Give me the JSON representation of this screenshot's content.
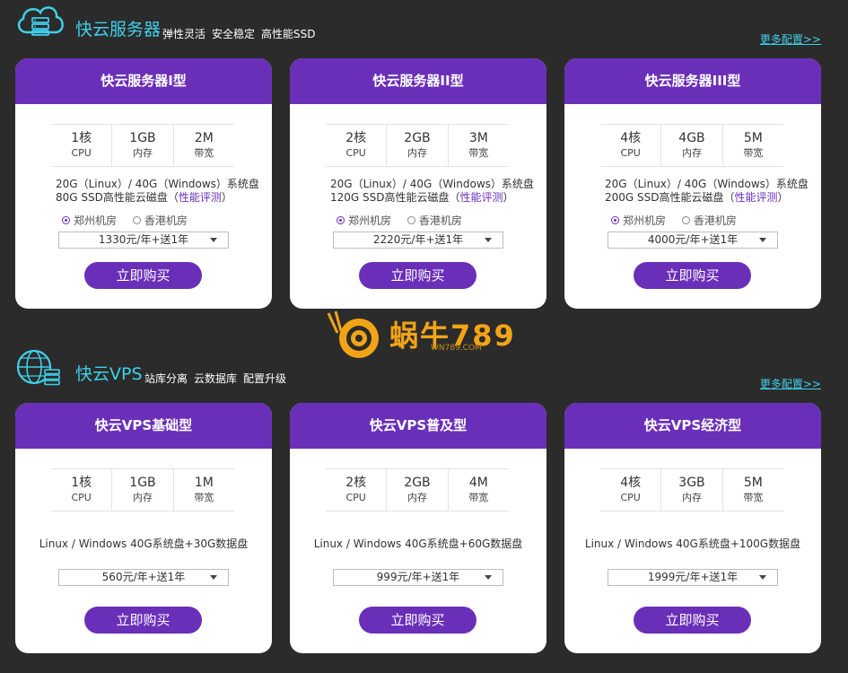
{
  "servers": {
    "title": "快云服务器",
    "tags": [
      "弹性灵活",
      "安全稳定",
      "高性能SSD"
    ],
    "more": "更多配置>>",
    "plans": [
      {
        "name": "快云服务器I型",
        "specs": [
          {
            "value": "1核",
            "label": "CPU"
          },
          {
            "value": "1GB",
            "label": "内存"
          },
          {
            "value": "2M",
            "label": "带宽"
          }
        ],
        "disk_line1": "20G（Linux）/ 40G（Windows）系统盘",
        "disk_line2": "80G SSD高性能云磁盘（",
        "eval": "性能评测",
        "eval_close": "）",
        "rooms": [
          "郑州机房",
          "香港机房"
        ],
        "price": "1330元/年+送1年",
        "buy": "立即购买"
      },
      {
        "name": "快云服务器II型",
        "specs": [
          {
            "value": "2核",
            "label": "CPU"
          },
          {
            "value": "2GB",
            "label": "内存"
          },
          {
            "value": "3M",
            "label": "带宽"
          }
        ],
        "disk_line1": "20G（Linux）/ 40G（Windows）系统盘",
        "disk_line2": "120G SSD高性能云磁盘（",
        "eval": "性能评测",
        "eval_close": "）",
        "rooms": [
          "郑州机房",
          "香港机房"
        ],
        "price": "2220元/年+送1年",
        "buy": "立即购买"
      },
      {
        "name": "快云服务器III型",
        "specs": [
          {
            "value": "4核",
            "label": "CPU"
          },
          {
            "value": "4GB",
            "label": "内存"
          },
          {
            "value": "5M",
            "label": "带宽"
          }
        ],
        "disk_line1": "20G（Linux）/ 40G（Windows）系统盘",
        "disk_line2": "200G SSD高性能云磁盘（",
        "eval": "性能评测",
        "eval_close": "）",
        "rooms": [
          "郑州机房",
          "香港机房"
        ],
        "price": "4000元/年+送1年",
        "buy": "立即购买"
      }
    ]
  },
  "vps": {
    "title": "快云VPS",
    "tags": [
      "站库分离",
      "云数据库",
      "配置升级"
    ],
    "more": "更多配置>>",
    "plans": [
      {
        "name": "快云VPS基础型",
        "specs": [
          {
            "value": "1核",
            "label": "CPU"
          },
          {
            "value": "1GB",
            "label": "内存"
          },
          {
            "value": "1M",
            "label": "带宽"
          }
        ],
        "disk": "Linux / Windows 40G系统盘+30G数据盘",
        "price": "560元/年+送1年",
        "buy": "立即购买"
      },
      {
        "name": "快云VPS普及型",
        "specs": [
          {
            "value": "2核",
            "label": "CPU"
          },
          {
            "value": "2GB",
            "label": "内存"
          },
          {
            "value": "4M",
            "label": "带宽"
          }
        ],
        "disk": "Linux / Windows 40G系统盘+60G数据盘",
        "price": "999元/年+送1年",
        "buy": "立即购买"
      },
      {
        "name": "快云VPS经济型",
        "specs": [
          {
            "value": "4核",
            "label": "CPU"
          },
          {
            "value": "3GB",
            "label": "内存"
          },
          {
            "value": "5M",
            "label": "带宽"
          }
        ],
        "disk": "Linux / Windows 40G系统盘+100G数据盘",
        "price": "1999元/年+送1年",
        "buy": "立即购买"
      }
    ]
  },
  "watermark": {
    "text": "蜗牛789",
    "sub": "WN789.COM"
  },
  "colors": {
    "accent": "#6a2fb8",
    "title": "#3fd0ea",
    "background": "#2b2b2b"
  }
}
